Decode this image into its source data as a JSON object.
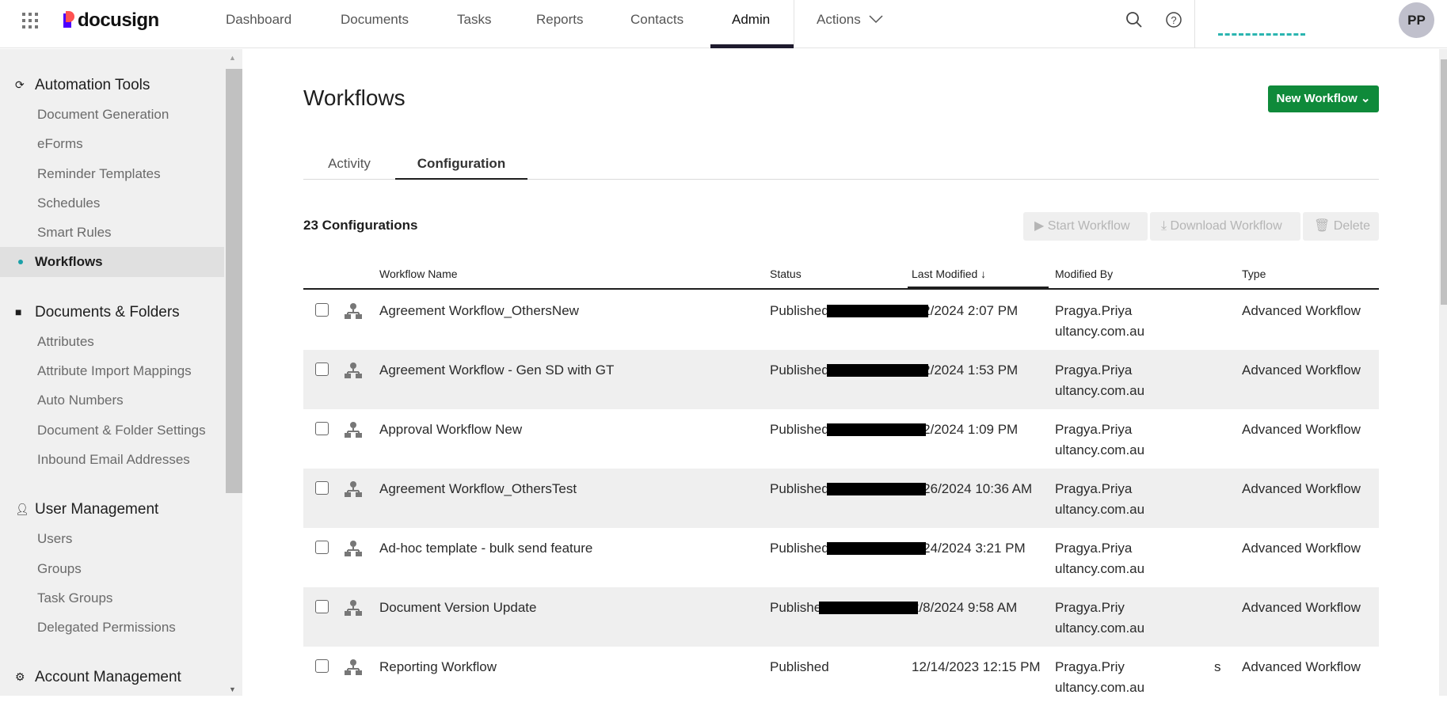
{
  "header": {
    "brand": "docusign",
    "nav": [
      "Dashboard",
      "Documents",
      "Tasks",
      "Reports",
      "Contacts",
      "Admin",
      "Actions"
    ],
    "active": "Admin",
    "avatar": "PP"
  },
  "sidebar": {
    "sections": [
      {
        "title": "Automation Tools",
        "icon": "automation-icon",
        "items": [
          "Document Generation",
          "eForms",
          "Reminder Templates",
          "Schedules",
          "Smart Rules",
          "Workflows"
        ]
      },
      {
        "title": "Documents & Folders",
        "icon": "folder-icon",
        "items": [
          "Attributes",
          "Attribute Import Mappings",
          "Auto Numbers",
          "Document & Folder Settings",
          "Inbound Email Addresses"
        ]
      },
      {
        "title": "User Management",
        "icon": "user-icon",
        "items": [
          "Users",
          "Groups",
          "Task Groups",
          "Delegated Permissions"
        ]
      },
      {
        "title": "Account Management",
        "icon": "gear-icon",
        "items": []
      }
    ],
    "active_item": "Workflows"
  },
  "page": {
    "title": "Workflows",
    "new_button": "New Workflow",
    "tabs": [
      "Activity",
      "Configuration"
    ],
    "active_tab": "Configuration",
    "count": "23 Configurations",
    "actions": {
      "start": "Start Workflow",
      "download": "Download Workflow",
      "delete": "Delete"
    }
  },
  "table": {
    "columns": {
      "name": "Workflow Name",
      "status": "Status",
      "modified": "Last Modified",
      "sort": "↓",
      "by": "Modified By",
      "type": "Type"
    },
    "rows": [
      {
        "name": "Agreement Workflow_OthersNew",
        "status": "Published",
        "modified": "7/2/2024 2:07 PM",
        "by1": "Pragya.Priya",
        "by2": "ultancy.com.au",
        "type": "Advanced Workflow"
      },
      {
        "name": "Agreement Workflow - Gen SD with GT",
        "status": "Published",
        "modified": "7/2/2024 1:53 PM",
        "by1": "Pragya.Priya",
        "by2": "ultancy.com.au",
        "type": "Advanced Workflow"
      },
      {
        "name": "Approval Workflow New",
        "status": "Published",
        "modified": "7/2/2024 1:09 PM",
        "by1": "Pragya.Priya",
        "by2": "ultancy.com.au",
        "type": "Advanced Workflow"
      },
      {
        "name": "Agreement Workflow_OthersTest",
        "status": "Published",
        "modified": "6/26/2024 10:36 AM",
        "by1": "Pragya.Priya",
        "by2": "ultancy.com.au",
        "type": "Advanced Workflow"
      },
      {
        "name": "Ad-hoc template - bulk send feature",
        "status": "Published",
        "modified": "4/24/2024 3:21 PM",
        "by1": "Pragya.Priya",
        "by2": "ultancy.com.au",
        "type": "Advanced Workflow"
      },
      {
        "name": "Document Version Update",
        "status": "Published",
        "modified": "2/8/2024 9:58 AM",
        "by1": "Pragya.Priy",
        "by2": "ultancy.com.au",
        "type": "Advanced Workflow"
      },
      {
        "name": "Reporting Workflow",
        "status": "Published",
        "modified": "12/14/2023 12:15 PM",
        "by1": "Pragya.Priy",
        "by2": "ultancy.com.au",
        "by_tail": "s",
        "type": "Advanced Workflow"
      }
    ]
  }
}
